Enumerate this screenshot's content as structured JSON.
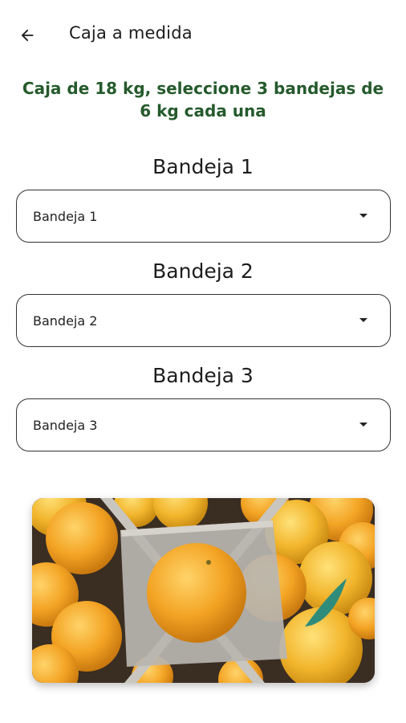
{
  "header": {
    "title": "Caja a medida",
    "back_icon": "arrow-left-icon"
  },
  "subtitle": "Caja de 18 kg, seleccione 3 bandejas de 6 kg cada una",
  "trays": [
    {
      "heading": "Bandeja 1",
      "select_value": "Bandeja 1"
    },
    {
      "heading": "Bandeja 2",
      "select_value": "Bandeja 2"
    },
    {
      "heading": "Bandeja 3",
      "select_value": "Bandeja 3"
    }
  ],
  "colors": {
    "accent_green": "#255a2c",
    "orange": "#f3a323",
    "cardboard": "#b9b5b0"
  },
  "image": {
    "subject": "oranges-in-cardboard-box"
  }
}
